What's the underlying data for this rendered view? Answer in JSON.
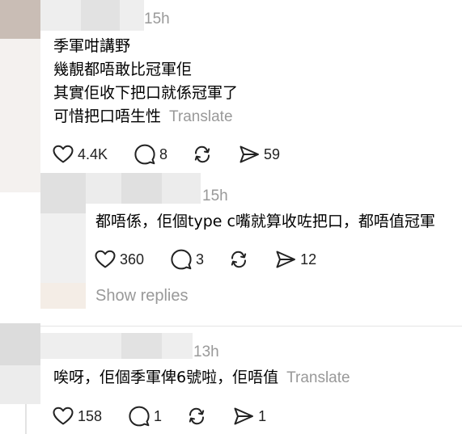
{
  "comments": [
    {
      "timestamp": "15h",
      "lines": [
        "季軍咁講野",
        "幾靚都唔敢比冠軍佢",
        "其實佢收下把口就係冠軍了",
        "可惜把口唔生性"
      ],
      "translate": "Translate",
      "likes": "4.4K",
      "replies": "8",
      "shares": "59"
    },
    {
      "timestamp": "15h",
      "lines": [
        "都唔係，佢個type c嘴就算收咗把口，都唔值冠軍"
      ],
      "likes": "360",
      "replies": "3",
      "shares": "12",
      "show_replies": "Show replies"
    },
    {
      "timestamp": "13h",
      "lines": [
        "唉呀，佢個季軍俾6號啦，佢唔值"
      ],
      "translate": "Translate",
      "likes": "158",
      "replies": "1",
      "shares": "1"
    }
  ]
}
